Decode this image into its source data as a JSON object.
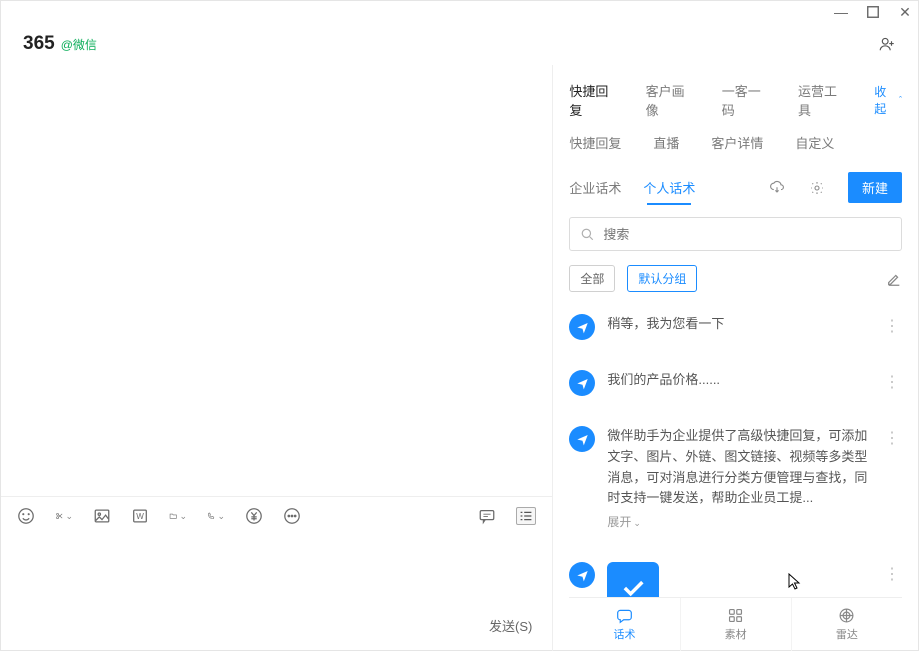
{
  "header": {
    "title": "365",
    "subtitle": "@微信"
  },
  "chat": {
    "send_label": "发送(S)"
  },
  "side": {
    "tabs_primary": [
      "快捷回复",
      "客户画像",
      "一客一码",
      "运营工具"
    ],
    "collapse_label": "收起",
    "tabs_secondary": [
      "快捷回复",
      "直播",
      "客户详情",
      "自定义"
    ],
    "script_tabs": {
      "enterprise": "企业话术",
      "personal": "个人话术"
    },
    "new_button": "新建",
    "search_placeholder": "搜索",
    "chips": {
      "all": "全部",
      "default_group": "默认分组"
    },
    "items": [
      {
        "text": "稍等，我为您看一下"
      },
      {
        "text": "我们的产品价格......"
      },
      {
        "text": "微伴助手为企业提供了高级快捷回复，可添加文字、图片、外链、图文链接、视频等多类型消息，可对消息进行分类方便管理与查找，同时支持一键发送，帮助企业员工提..."
      }
    ],
    "expand_label": "展开"
  },
  "bottom_nav": {
    "script": "话术",
    "material": "素材",
    "radar": "雷达"
  }
}
